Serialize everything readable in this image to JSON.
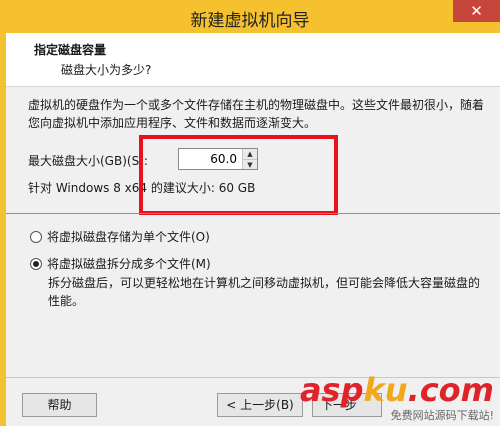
{
  "window": {
    "title": "新建虚拟机向导",
    "close_label": "✕"
  },
  "header": {
    "title": "指定磁盘容量",
    "subtitle": "磁盘大小为多少?"
  },
  "content": {
    "description": "虚拟机的硬盘作为一个或多个文件存储在主机的物理磁盘中。这些文件最初很小，随着您向虚拟机中添加应用程序、文件和数据而逐渐变大。",
    "max_size_label": "最大磁盘大小(GB)(S):",
    "max_size_value": "60.0",
    "recommended": "针对 Windows 8 x64 的建议大小: 60 GB",
    "options": [
      {
        "label": "将虚拟磁盘存储为单个文件(O)",
        "checked": false
      },
      {
        "label": "将虚拟磁盘拆分成多个文件(M)",
        "checked": true
      }
    ],
    "split_description": "拆分磁盘后，可以更轻松地在计算机之间移动虚拟机，但可能会降低大容量磁盘的性能。"
  },
  "buttons": {
    "help": "帮助",
    "back": "< 上一步(B)",
    "next": "下一步"
  },
  "watermark": {
    "logo_a": "asp",
    "logo_b": "ku",
    "logo_c": ".com",
    "sub": "免费网站源码下载站!"
  },
  "colors": {
    "title_bar": "#f5c12e",
    "highlight": "#e8121f",
    "close": "#c7463b"
  }
}
